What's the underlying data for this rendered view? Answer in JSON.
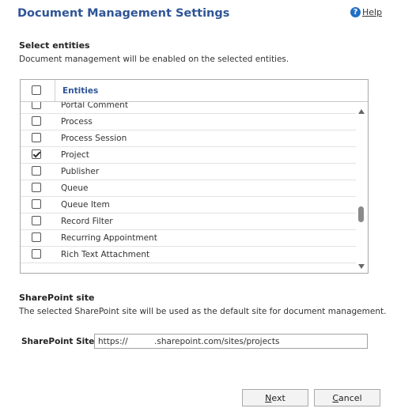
{
  "dialog": {
    "title": "Document Management Settings",
    "help_label": "Help",
    "help_icon": "question-circle-icon"
  },
  "select_entities": {
    "heading": "Select entities",
    "description": "Document management will be enabled on the selected entities."
  },
  "grid": {
    "column_header": "Entities",
    "header_checked": false,
    "rows": [
      {
        "label": "Portal Comment",
        "checked": false
      },
      {
        "label": "Process",
        "checked": false
      },
      {
        "label": "Process Session",
        "checked": false
      },
      {
        "label": "Project",
        "checked": true
      },
      {
        "label": "Publisher",
        "checked": false
      },
      {
        "label": "Queue",
        "checked": false
      },
      {
        "label": "Queue Item",
        "checked": false
      },
      {
        "label": "Record Filter",
        "checked": false
      },
      {
        "label": "Recurring Appointment",
        "checked": false
      },
      {
        "label": "Rich Text Attachment",
        "checked": false
      }
    ]
  },
  "sharepoint": {
    "heading": "SharePoint site",
    "description": "The selected SharePoint site will be used as the default site for document management.",
    "site_label": "SharePoint Site:",
    "site_value": "https://          .sharepoint.com/sites/projects"
  },
  "buttons": {
    "next_first": "N",
    "next_rest": "ext",
    "cancel_first": "C",
    "cancel_rest": "ancel"
  }
}
